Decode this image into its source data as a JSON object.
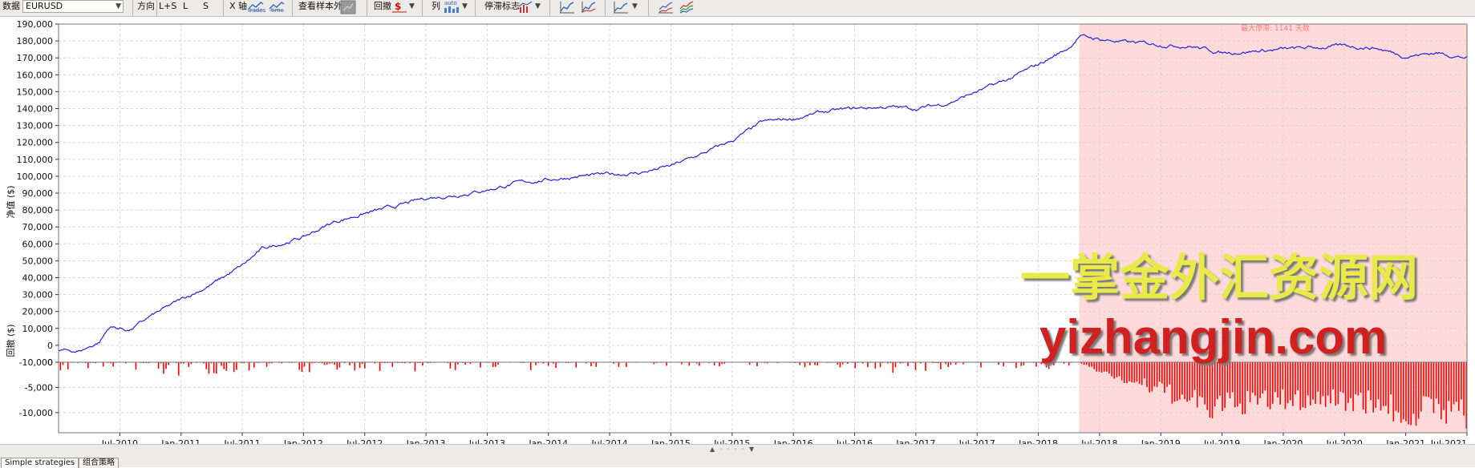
{
  "toolbar": {
    "data_label": "数据",
    "symbol": "EURUSD",
    "direction_label": "方向",
    "dir_ls": "L+S",
    "dir_l": "L",
    "dir_s": "S",
    "xaxis_label": "X 轴",
    "trades_label": "trades",
    "time_label": "time",
    "oos_label": "查看样本外",
    "drawdown_label": "回撤",
    "columns_label": "列",
    "auto_label": "auto",
    "stagnation_label": "停滞标志"
  },
  "footer": {
    "tab1": "Simple strategies",
    "tab2": "组合策略"
  },
  "watermark": {
    "cn": "一掌金外汇资源网",
    "en": "yizhangjin.com"
  },
  "colors": {
    "equity_line": "#2323d8",
    "drawdown_bar": "#ff0000",
    "stagnation_fill": "#ffdada",
    "watermark_cn": "#e9e94a",
    "watermark_en": "#d02020"
  },
  "chart_data": {
    "type": "line",
    "ylabel_top": "净值 ($)",
    "ylabel_bottom": "回撤 ($)",
    "ylim_top": [
      -10000,
      190000
    ],
    "ylim_bottom": [
      -14000,
      0
    ],
    "yticks_top": [
      "190,000",
      "180,000",
      "170,000",
      "160,000",
      "150,000",
      "140,000",
      "130,000",
      "120,000",
      "110,000",
      "100,000",
      "90,000",
      "80,000",
      "70,000",
      "60,000",
      "50,000",
      "40,000",
      "30,000",
      "20,000",
      "10,000",
      "0",
      "-10,000"
    ],
    "yticks_bottom": [
      "0",
      "-5,000",
      "-10,000"
    ],
    "xticks": [
      "Jul-2010",
      "Jan-2011",
      "Jul-2011",
      "Jan-2012",
      "Jul-2012",
      "Jan-2013",
      "Jul-2013",
      "Jan-2014",
      "Jul-2014",
      "Jan-2015",
      "Jul-2015",
      "Jan-2016",
      "Jul-2016",
      "Jan-2017",
      "Jul-2017",
      "Jan-2018",
      "Jul-2018",
      "Jan-2019",
      "Jul-2019",
      "Jan-2020",
      "Jul-2020",
      "Jan-2021",
      "Jul-2021"
    ],
    "x_start": "2010-01",
    "x_end": "2021-07",
    "stagnation": {
      "label": "最大停滞: 1141 天数",
      "from": "2018-05",
      "to": "2021-07"
    },
    "equity": {
      "x": [
        "2010-01",
        "2010-03",
        "2010-04",
        "2010-05",
        "2010-06",
        "2010-08",
        "2010-10",
        "2011-01",
        "2011-04",
        "2011-07",
        "2011-09",
        "2012-01",
        "2012-04",
        "2012-07",
        "2012-10",
        "2013-01",
        "2013-04",
        "2013-07",
        "2013-10",
        "2014-01",
        "2014-04",
        "2014-07",
        "2014-10",
        "2015-01",
        "2015-04",
        "2015-07",
        "2015-10",
        "2016-01",
        "2016-04",
        "2016-07",
        "2016-10",
        "2017-01",
        "2017-04",
        "2017-07",
        "2017-10",
        "2018-01",
        "2018-04",
        "2018-05",
        "2018-07",
        "2018-10",
        "2019-01",
        "2019-04",
        "2019-07",
        "2019-10",
        "2020-01",
        "2020-04",
        "2020-07",
        "2020-10",
        "2021-01",
        "2021-04",
        "2021-07"
      ],
      "y": [
        -3000,
        -3500,
        -1000,
        2000,
        11000,
        9000,
        17000,
        27000,
        36000,
        47000,
        57000,
        64000,
        73000,
        78000,
        82000,
        87000,
        89000,
        92000,
        96000,
        98000,
        100000,
        101000,
        102000,
        106000,
        113000,
        121000,
        132000,
        134000,
        138000,
        140000,
        141000,
        140000,
        143000,
        150000,
        157000,
        166000,
        176000,
        183000,
        181000,
        179000,
        178000,
        177000,
        173000,
        174000,
        175000,
        176000,
        177000,
        176000,
        171000,
        173000,
        170000
      ]
    },
    "drawdown": {
      "x": [
        "2010-01",
        "2010-06",
        "2011-01",
        "2011-06",
        "2012-01",
        "2012-06",
        "2013-01",
        "2013-06",
        "2014-01",
        "2014-06",
        "2015-01",
        "2015-06",
        "2016-01",
        "2016-06",
        "2017-01",
        "2017-06",
        "2018-01",
        "2018-05",
        "2018-09",
        "2019-01",
        "2019-06",
        "2019-09",
        "2020-01",
        "2020-06",
        "2020-10",
        "2021-01",
        "2021-04",
        "2021-07"
      ],
      "y": [
        -1500,
        -2000,
        -2500,
        -1800,
        -2200,
        -1500,
        -1800,
        -1200,
        -1500,
        -900,
        -1000,
        -800,
        -1500,
        -1000,
        -2500,
        -800,
        -1500,
        -300,
        -4000,
        -7000,
        -11500,
        -10000,
        -9500,
        -9000,
        -10000,
        -13000,
        -11000,
        -13500
      ]
    }
  }
}
